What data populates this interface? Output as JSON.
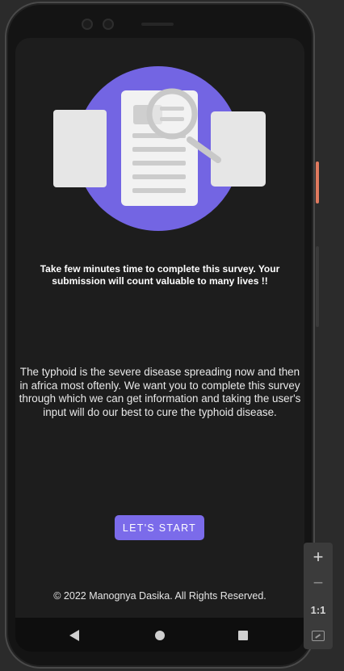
{
  "app": {
    "lead_text": "Take few minutes time to complete this survey. Your submission will count valuable to many lives !!",
    "description": "The typhoid is the severe disease spreading now and then in africa most oftenly. We want you to complete this survey through which we can get information and taking the user's input will do our best to cure the typhoid disease.",
    "start_button_label": "LET'S START",
    "footer": "© 2022 Manognya Dasika. All Rights Reserved."
  },
  "emulator": {
    "zoom_in_label": "+",
    "zoom_out_label": "−",
    "actual_size_label": "1:1"
  },
  "colors": {
    "accent": "#7b6bea",
    "screen_background": "#1d1d1d",
    "illustration_circle": "#7365e3",
    "card_gray": "#e6e6e6"
  },
  "icons": {
    "illustration": "survey-document-search-illustration",
    "nav": [
      "back-icon",
      "home-icon",
      "recents-icon"
    ],
    "zoom": [
      "plus-icon",
      "minus-icon",
      "actual-size-icon",
      "fit-screen-icon"
    ]
  }
}
